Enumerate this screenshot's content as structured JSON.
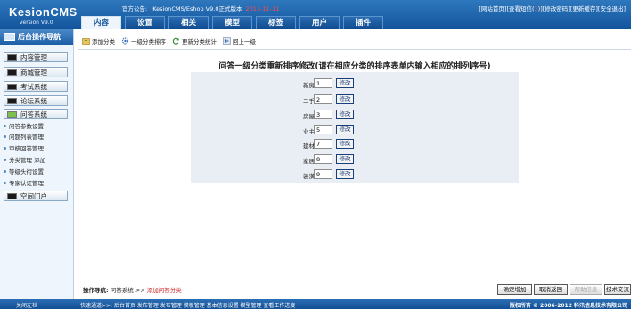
{
  "brand": {
    "name": "KesionCMS",
    "version": "version V9.0"
  },
  "notice": {
    "label": "官方公告:",
    "link": "KesionCMS/Eshop V9.0正式版本",
    "date": "2011-11-11"
  },
  "top_links": {
    "home": "[网站首页]",
    "messages_pre": "[查看短信(",
    "messages_count": "3",
    "messages_post": ")]",
    "change_password": "[修改密码]",
    "update_cache": "[更新缓存]",
    "logout": "[安全退出]"
  },
  "tabs": [
    "内容",
    "设置",
    "相关",
    "模型",
    "标签",
    "用户",
    "插件"
  ],
  "sidebar": {
    "header": "后台操作导航",
    "nav": [
      "内容管理",
      "商城管理",
      "考试系统",
      "论坛系统",
      "问答系统"
    ],
    "sub_items": [
      "问答参数设置",
      "问题列表管理",
      "审核回答管理",
      "分类管理 添加",
      "等级头衔设置",
      "专家认证管理"
    ],
    "space": "空间门户"
  },
  "toolbar": [
    "添加分类",
    "一级分类排序",
    "更新分类统计",
    "回上一级"
  ],
  "panel": {
    "title": "问答一级分类重新排序修改(请在相应分类的排序表单内输入相应的排列序号)",
    "button_label": "修改",
    "rows": [
      {
        "label": "新房置业",
        "value": "1"
      },
      {
        "label": "二手房源",
        "value": "2"
      },
      {
        "label": "房屋租赁",
        "value": "3"
      },
      {
        "label": "业主生活",
        "value": "5"
      },
      {
        "label": "建材知识",
        "value": "7"
      },
      {
        "label": "家居用品",
        "value": "8"
      },
      {
        "label": "装潢装修",
        "value": "9"
      }
    ]
  },
  "footer": {
    "crumb_label": "操作导航:",
    "crumb_path": "问答系统",
    "crumb_sep": ">>",
    "crumb_current": "添加问答分类",
    "buttons": [
      "确定增加",
      "取消返回",
      "帮助信息",
      "技术交流"
    ]
  },
  "bottom": {
    "close_left": "关闭左栏",
    "quick": "快速通道>>: 后台首页 发布管理 发布管理 模板管理 基本信息设置 模型管理 查看工作进度",
    "copyright": "版权所有 © 2006-2012 科汛信息技术有限公司"
  },
  "colors": {
    "primary": "#12549b",
    "accent_red": "#cc2222",
    "panel_bg": "#e9eef4",
    "sidebar_bg": "#eef5fc"
  }
}
